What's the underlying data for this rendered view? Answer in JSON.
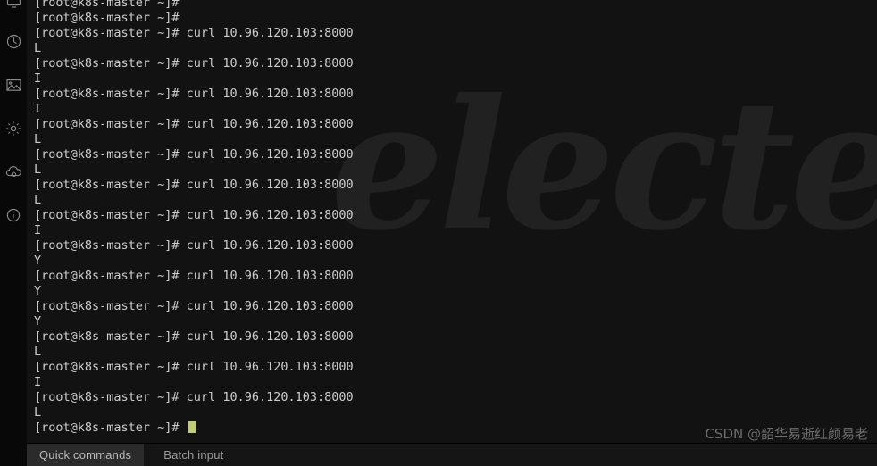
{
  "window": {
    "app_name": "electerm",
    "background_watermark": "electerm",
    "terminal_bg": "#121212",
    "sidebar_bg": "#080808",
    "text_color": "#cdcdcd",
    "cursor_color": "#c3ca79"
  },
  "sidebar": {
    "items": [
      {
        "name": "monitor-icon",
        "label": "Monitor"
      },
      {
        "name": "clock-icon",
        "label": "History"
      },
      {
        "name": "image-icon",
        "label": "Theme"
      },
      {
        "name": "gear-icon",
        "label": "Settings"
      },
      {
        "name": "cloud-icon",
        "label": "Sync"
      },
      {
        "name": "info-icon",
        "label": "About"
      }
    ]
  },
  "terminal": {
    "prompt": "[root@k8s-master ~]#",
    "command": "curl 10.96.120.103:8000",
    "host": "k8s-master",
    "user": "root",
    "target_ip": "10.96.120.103",
    "target_port": "8000",
    "lines": [
      {
        "type": "prompt",
        "text": "[root@k8s-master ~]#"
      },
      {
        "type": "prompt",
        "text": "[root@k8s-master ~]#"
      },
      {
        "type": "prompt",
        "text": "[root@k8s-master ~]# curl 10.96.120.103:8000"
      },
      {
        "type": "output",
        "text": "L"
      },
      {
        "type": "prompt",
        "text": "[root@k8s-master ~]# curl 10.96.120.103:8000"
      },
      {
        "type": "output",
        "text": "I"
      },
      {
        "type": "prompt",
        "text": "[root@k8s-master ~]# curl 10.96.120.103:8000"
      },
      {
        "type": "output",
        "text": "I"
      },
      {
        "type": "prompt",
        "text": "[root@k8s-master ~]# curl 10.96.120.103:8000"
      },
      {
        "type": "output",
        "text": "L"
      },
      {
        "type": "prompt",
        "text": "[root@k8s-master ~]# curl 10.96.120.103:8000"
      },
      {
        "type": "output",
        "text": "L"
      },
      {
        "type": "prompt",
        "text": "[root@k8s-master ~]# curl 10.96.120.103:8000"
      },
      {
        "type": "output",
        "text": "L"
      },
      {
        "type": "prompt",
        "text": "[root@k8s-master ~]# curl 10.96.120.103:8000"
      },
      {
        "type": "output",
        "text": "I"
      },
      {
        "type": "prompt",
        "text": "[root@k8s-master ~]# curl 10.96.120.103:8000"
      },
      {
        "type": "output",
        "text": "Y"
      },
      {
        "type": "prompt",
        "text": "[root@k8s-master ~]# curl 10.96.120.103:8000"
      },
      {
        "type": "output",
        "text": "Y"
      },
      {
        "type": "prompt",
        "text": "[root@k8s-master ~]# curl 10.96.120.103:8000"
      },
      {
        "type": "output",
        "text": "Y"
      },
      {
        "type": "prompt",
        "text": "[root@k8s-master ~]# curl 10.96.120.103:8000"
      },
      {
        "type": "output",
        "text": "L"
      },
      {
        "type": "prompt",
        "text": "[root@k8s-master ~]# curl 10.96.120.103:8000"
      },
      {
        "type": "output",
        "text": "I"
      },
      {
        "type": "prompt",
        "text": "[root@k8s-master ~]# curl 10.96.120.103:8000"
      },
      {
        "type": "output",
        "text": "L"
      },
      {
        "type": "cursor",
        "text": "[root@k8s-master ~]# "
      }
    ]
  },
  "bottom_bar": {
    "tabs": [
      {
        "label": "Quick commands",
        "active": true
      },
      {
        "label": "Batch input",
        "active": false
      }
    ]
  },
  "watermark": {
    "text": "CSDN @韶华易逝红颜易老"
  }
}
